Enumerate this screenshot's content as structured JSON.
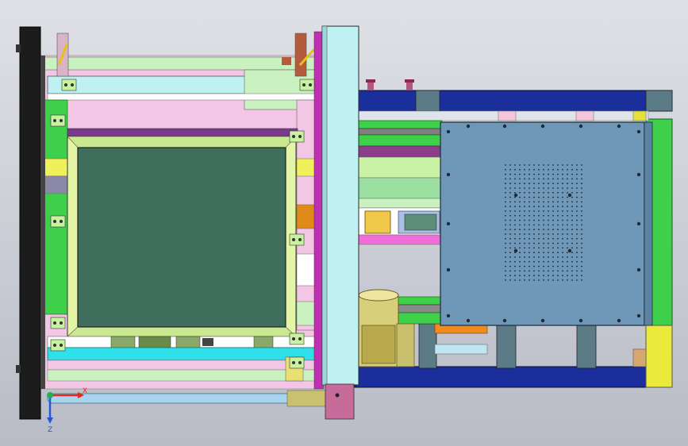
{
  "viewport": {
    "background_top": "#dfe1e6",
    "background_bottom": "#b9bcc6"
  },
  "triad": {
    "x_label": "X",
    "z_label": "Z",
    "x_color": "#e8261e",
    "z_color": "#2457d6",
    "y_color": "#22b14c"
  },
  "colors": {
    "frame_black": "#1c1c1c",
    "rail_blue": "#1a2f9c",
    "plate_blue": "#6f98b8",
    "screen_green": "#3f6e5c",
    "light_green": "#c9f2c0",
    "pink": "#f3c6e6",
    "cyan_panel": "#bff0f2",
    "yellow": "#f0f05a",
    "magenta": "#c02fb0"
  }
}
